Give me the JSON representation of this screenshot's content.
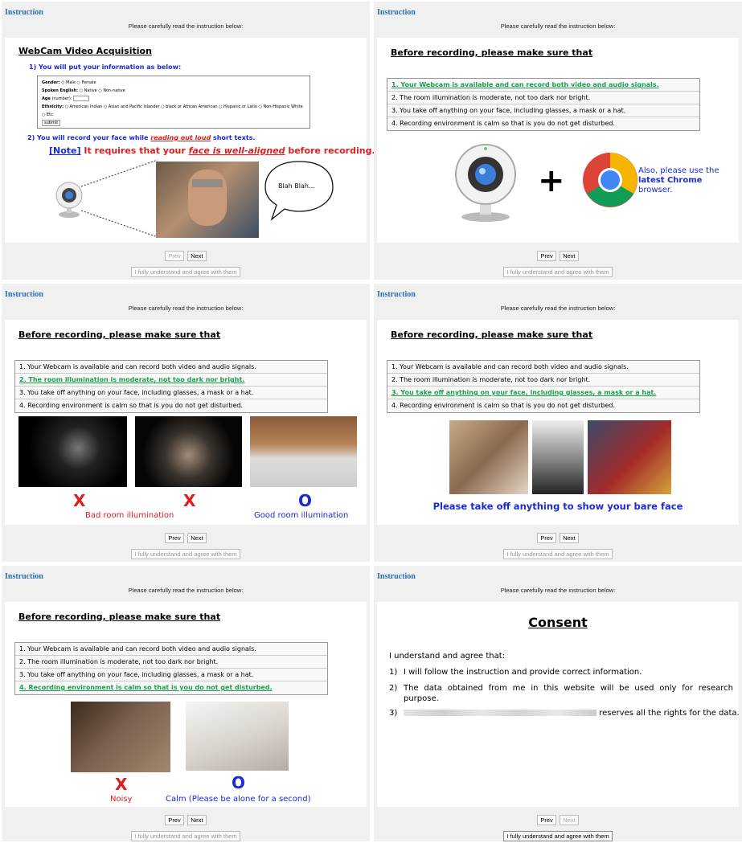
{
  "common": {
    "title": "Instruction",
    "subtitle": "Please carefully read the instruction below:",
    "prev": "Prev",
    "next": "Next",
    "agree": "I fully understand and agree with them",
    "heading": "Before recording, please make sure that",
    "items": [
      "1. Your Webcam is available and can record both video and audio signals.",
      "2. The room illumination is moderate, not too dark nor bright.",
      "3. You take off anything on your face, including glasses, a mask or a hat.",
      "4. Recording environment is calm so that is you do not get disturbed."
    ]
  },
  "p1": {
    "heading": "WebCam Video Acquisition",
    "step1": "1) You will put your information as below:",
    "form": {
      "gender": "Gender:",
      "male": "Male",
      "female": "Female",
      "english": "Spoken English:",
      "native": "Native",
      "nonnative": "Non-native",
      "age": "Age",
      "age_hint": "(number):",
      "ethnicity": "Ethnicity:",
      "eth_options": "American Indian  ○ Asian and Pacific Islander  ○ black or African American  ○ Hispanic or Latio  ○ Non-Hispanic White  ○ Etc.",
      "submit": "submit"
    },
    "step2a": "2) You will record your face while ",
    "step2b": "reading out loud",
    "step2c": " short texts.",
    "note_a": "[Note]",
    "note_b": " It requires that your ",
    "note_c": "face is well-aligned",
    "note_d": " before recording.",
    "bubble": "Blah Blah..."
  },
  "p2": {
    "chrome_a": "Also, please use the ",
    "chrome_b": "latest Chrome",
    "chrome_c": " browser."
  },
  "p3": {
    "x": "X",
    "o": "O",
    "bad": "Bad room illumination",
    "good": "Good room illumination"
  },
  "p4": {
    "caption": "Please take off anything to show your bare face"
  },
  "p5": {
    "x": "X",
    "o": "O",
    "noisy": "Noisy",
    "calm": "Calm (Please be alone for a second)"
  },
  "p6": {
    "heading": "Consent",
    "intro": "I understand and agree that:",
    "c1n": "1)",
    "c1": "I will follow the instruction and provide correct information.",
    "c2n": "2)",
    "c2": "The data obtained from me in this website will be used only for research purpose.",
    "c3n": "3)",
    "c3": "reserves all the rights for the data."
  },
  "colors": {
    "title_blue": "#2a6db5",
    "highlight_green": "#1aa14a",
    "red": "#e21b1b",
    "blue": "#1a2ad6"
  }
}
